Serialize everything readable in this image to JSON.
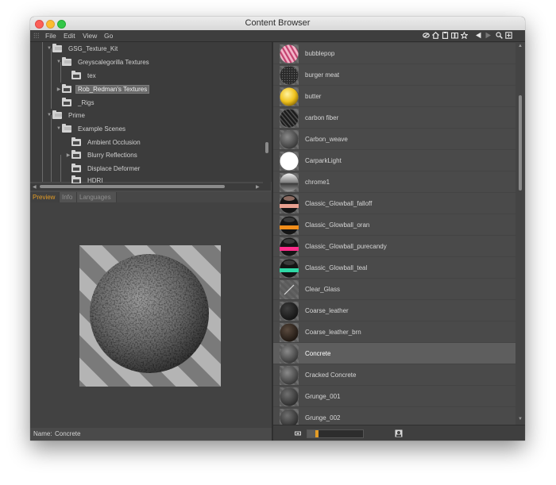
{
  "window": {
    "title": "Content Browser"
  },
  "menu": {
    "items": [
      "File",
      "Edit",
      "View",
      "Go"
    ]
  },
  "toolbar": {
    "icons": [
      "link-icon",
      "home-icon",
      "file-icon",
      "book-icon",
      "star-icon",
      "back-icon",
      "forward-icon",
      "search-icon",
      "new-folder-icon"
    ]
  },
  "tree": {
    "items": [
      {
        "label": "GSG_Texture_Kit",
        "depth": 1,
        "expanded": true
      },
      {
        "label": "Greyscalegorilla Textures",
        "depth": 2,
        "expanded": true
      },
      {
        "label": "tex",
        "depth": 3,
        "expanded": false
      },
      {
        "label": "Rob_Redman's Textures",
        "depth": 2,
        "expanded": false,
        "selected": true
      },
      {
        "label": "_Rigs",
        "depth": 2,
        "expanded": false
      },
      {
        "label": "Prime",
        "depth": 1,
        "expanded": true
      },
      {
        "label": "Example Scenes",
        "depth": 2,
        "expanded": true
      },
      {
        "label": "Ambient Occlusion",
        "depth": 3,
        "expanded": false
      },
      {
        "label": "Blurry Reflections",
        "depth": 3,
        "expanded": false
      },
      {
        "label": "Displace Deformer",
        "depth": 3,
        "expanded": false
      },
      {
        "label": "HDRI",
        "depth": 3,
        "expanded": false
      }
    ]
  },
  "tabs": [
    {
      "label": "Preview",
      "active": true
    },
    {
      "label": "Info",
      "active": false
    },
    {
      "label": "Languages",
      "active": false
    }
  ],
  "name_field": {
    "label": "Name:",
    "value": "Concrete"
  },
  "materials": {
    "items": [
      {
        "label": "bubblepop",
        "selected": false
      },
      {
        "label": "burger meat",
        "selected": false
      },
      {
        "label": "butter",
        "selected": false
      },
      {
        "label": "carbon fiber",
        "selected": false
      },
      {
        "label": "Carbon_weave",
        "selected": false
      },
      {
        "label": "CarparkLight",
        "selected": false
      },
      {
        "label": "chrome1",
        "selected": false
      },
      {
        "label": "Classic_Glowball_falloff",
        "selected": false
      },
      {
        "label": "Classic_Glowball_oran",
        "selected": false
      },
      {
        "label": "Classic_Glowball_purecandy",
        "selected": false
      },
      {
        "label": "Classic_Glowball_teal",
        "selected": false
      },
      {
        "label": "Clear_Glass",
        "selected": false
      },
      {
        "label": "Coarse_leather",
        "selected": false
      },
      {
        "label": "Coarse_leather_brn",
        "selected": false
      },
      {
        "label": "Concrete",
        "selected": true
      },
      {
        "label": "Cracked Concrete",
        "selected": false
      },
      {
        "label": "Grunge_001",
        "selected": false
      },
      {
        "label": "Grunge_002",
        "selected": false
      }
    ]
  },
  "thumbnail_size": {
    "level": 0.2
  },
  "colors": {
    "accent": "#e39c26",
    "selection": "#5e5e5e",
    "panel": "#4a4a4a"
  }
}
